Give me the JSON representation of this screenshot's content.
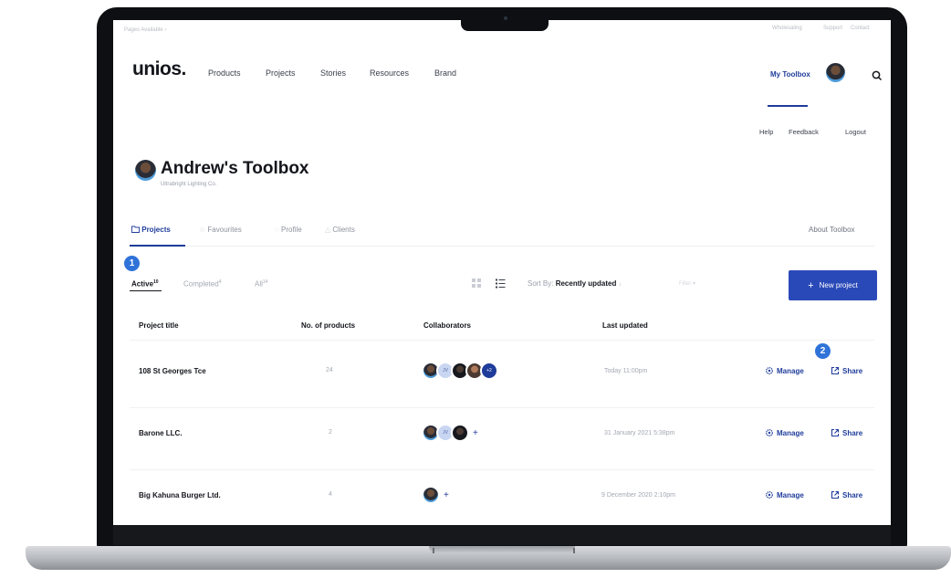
{
  "topbar": {
    "left_text": "Pages Available ›",
    "right_links": [
      "Wholesaling",
      "Support",
      "Contact"
    ]
  },
  "header": {
    "logo": "unios.",
    "nav": [
      "Products",
      "Projects",
      "Stories",
      "Resources",
      "Brand"
    ],
    "my_toolbox": "My Toolbox",
    "links": [
      "Help",
      "Feedback",
      "Logout"
    ]
  },
  "page": {
    "title": "Andrew's Toolbox",
    "company": "Ultrabright Lighting Co.",
    "about_link": "About Toolbox"
  },
  "tabs": [
    {
      "label": "Projects",
      "icon": "folder-icon"
    },
    {
      "label": "Favourites",
      "icon": "star-icon"
    },
    {
      "label": "Profile",
      "icon": "user-icon"
    },
    {
      "label": "Clients",
      "icon": "clients-icon"
    }
  ],
  "filters": {
    "active": {
      "label": "Active",
      "count": "10"
    },
    "completed": {
      "label": "Completed",
      "count": "4"
    },
    "all": {
      "label": "All",
      "count": "14"
    }
  },
  "sort": {
    "label": "Sort By:",
    "value": "Recently updated",
    "caret": "↓",
    "extra": "Filter ▾"
  },
  "new_project_label": "New project",
  "new_project_plus": "+",
  "table": {
    "headers": [
      "Project title",
      "No. of products",
      "Collaborators",
      "Last updated"
    ],
    "rows": [
      {
        "title": "108 St Georges Tce",
        "products": "24",
        "collab_initials": "JV",
        "collab_more": "+2",
        "updated": "Today 11:00pm",
        "manage": "Manage",
        "share": "Share"
      },
      {
        "title": "Barone LLC.",
        "products": "2",
        "collab_initials": "JV",
        "collab_more": "+",
        "updated": "31 January 2021 5:38pm",
        "manage": "Manage",
        "share": "Share"
      },
      {
        "title": "Big Kahuna Burger Ltd.",
        "products": "4",
        "collab_more": "+",
        "updated": "9 December 2020 2:10pm",
        "manage": "Manage",
        "share": "Share"
      }
    ]
  },
  "callouts": [
    "1",
    "2"
  ],
  "colors": {
    "accent": "#1f3c9b",
    "button": "#2a49b8",
    "callout": "#2f73d9",
    "frame": "#0e0f12"
  }
}
